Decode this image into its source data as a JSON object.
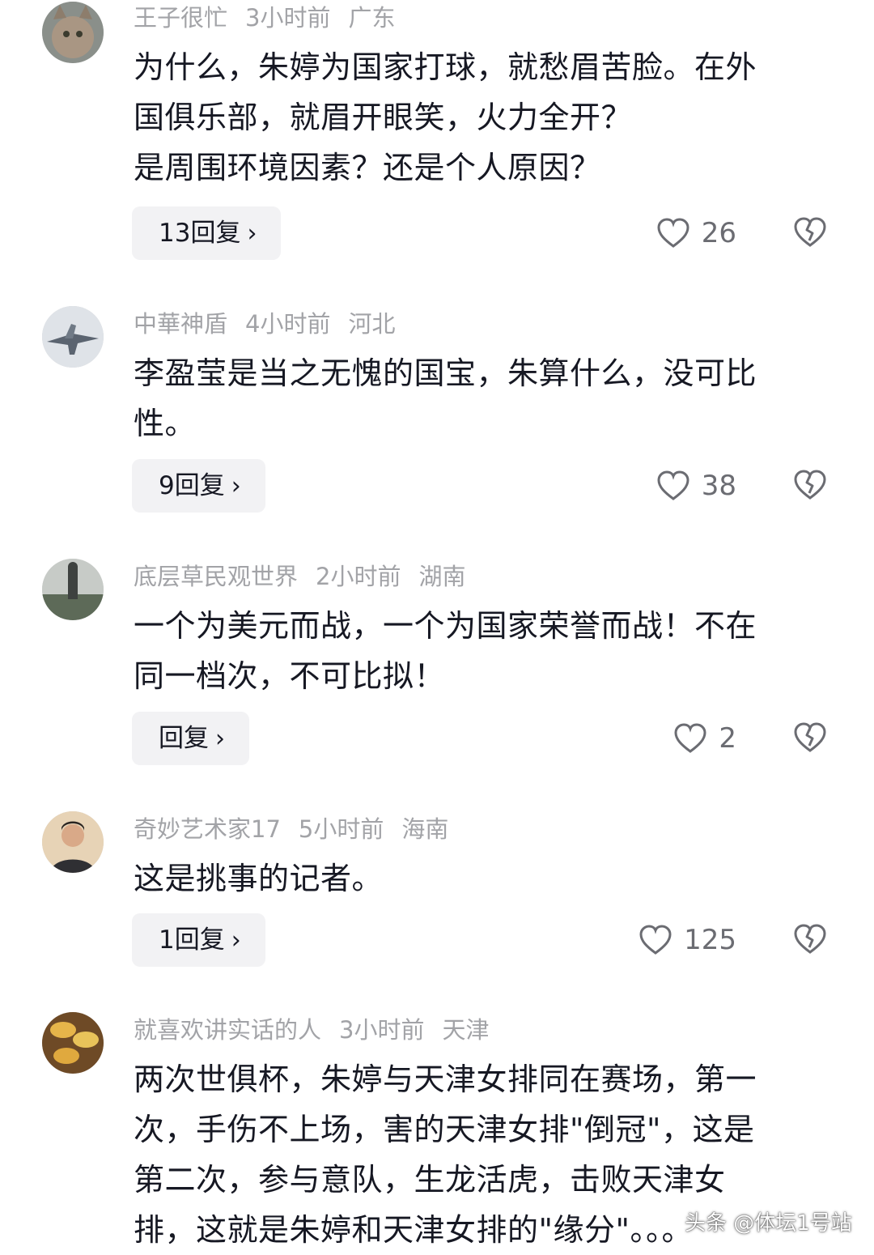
{
  "comments": [
    {
      "user": "王子很忙",
      "time": "3小时前",
      "location": "广东",
      "lines": [
        "为什么，朱婷为国家打球，就愁眉苦脸。在外",
        "国俱乐部，就眉开眼笑，火力全开？",
        "是周围环境因素？还是个人原因？"
      ],
      "reply_label": "13回复",
      "likes": "26"
    },
    {
      "user": "中華神盾",
      "time": "4小时前",
      "location": "河北",
      "lines": [
        "李盈莹是当之无愧的国宝，朱算什么，没可比",
        "性。"
      ],
      "reply_label": "9回复",
      "likes": "38"
    },
    {
      "user": "底层草民观世界",
      "time": "2小时前",
      "location": "湖南",
      "lines": [
        "一个为美元而战，一个为国家荣誉而战！不在",
        "同一档次，不可比拟！"
      ],
      "reply_label": "回复",
      "likes": "2"
    },
    {
      "user": "奇妙艺术家17",
      "time": "5小时前",
      "location": "海南",
      "lines": [
        "这是挑事的记者。"
      ],
      "reply_label": "1回复",
      "likes": "125"
    },
    {
      "user": "就喜欢讲实话的人",
      "time": "3小时前",
      "location": "天津",
      "lines": [
        "两次世俱杯，朱婷与天津女排同在赛场，第一",
        "次，手伤不上场，害的天津女排\"倒冠\"，这是",
        "第二次，参与意队，生龙活虎，击败天津女",
        "排，这就是朱婷和天津女排的\"缘分\"。。。"
      ]
    }
  ],
  "icons": {
    "like": "heart-outline-icon",
    "dislike": "broken-heart-icon",
    "reply_arrow": "chevron-right-icon"
  },
  "watermark": "头条 @体坛1号站"
}
